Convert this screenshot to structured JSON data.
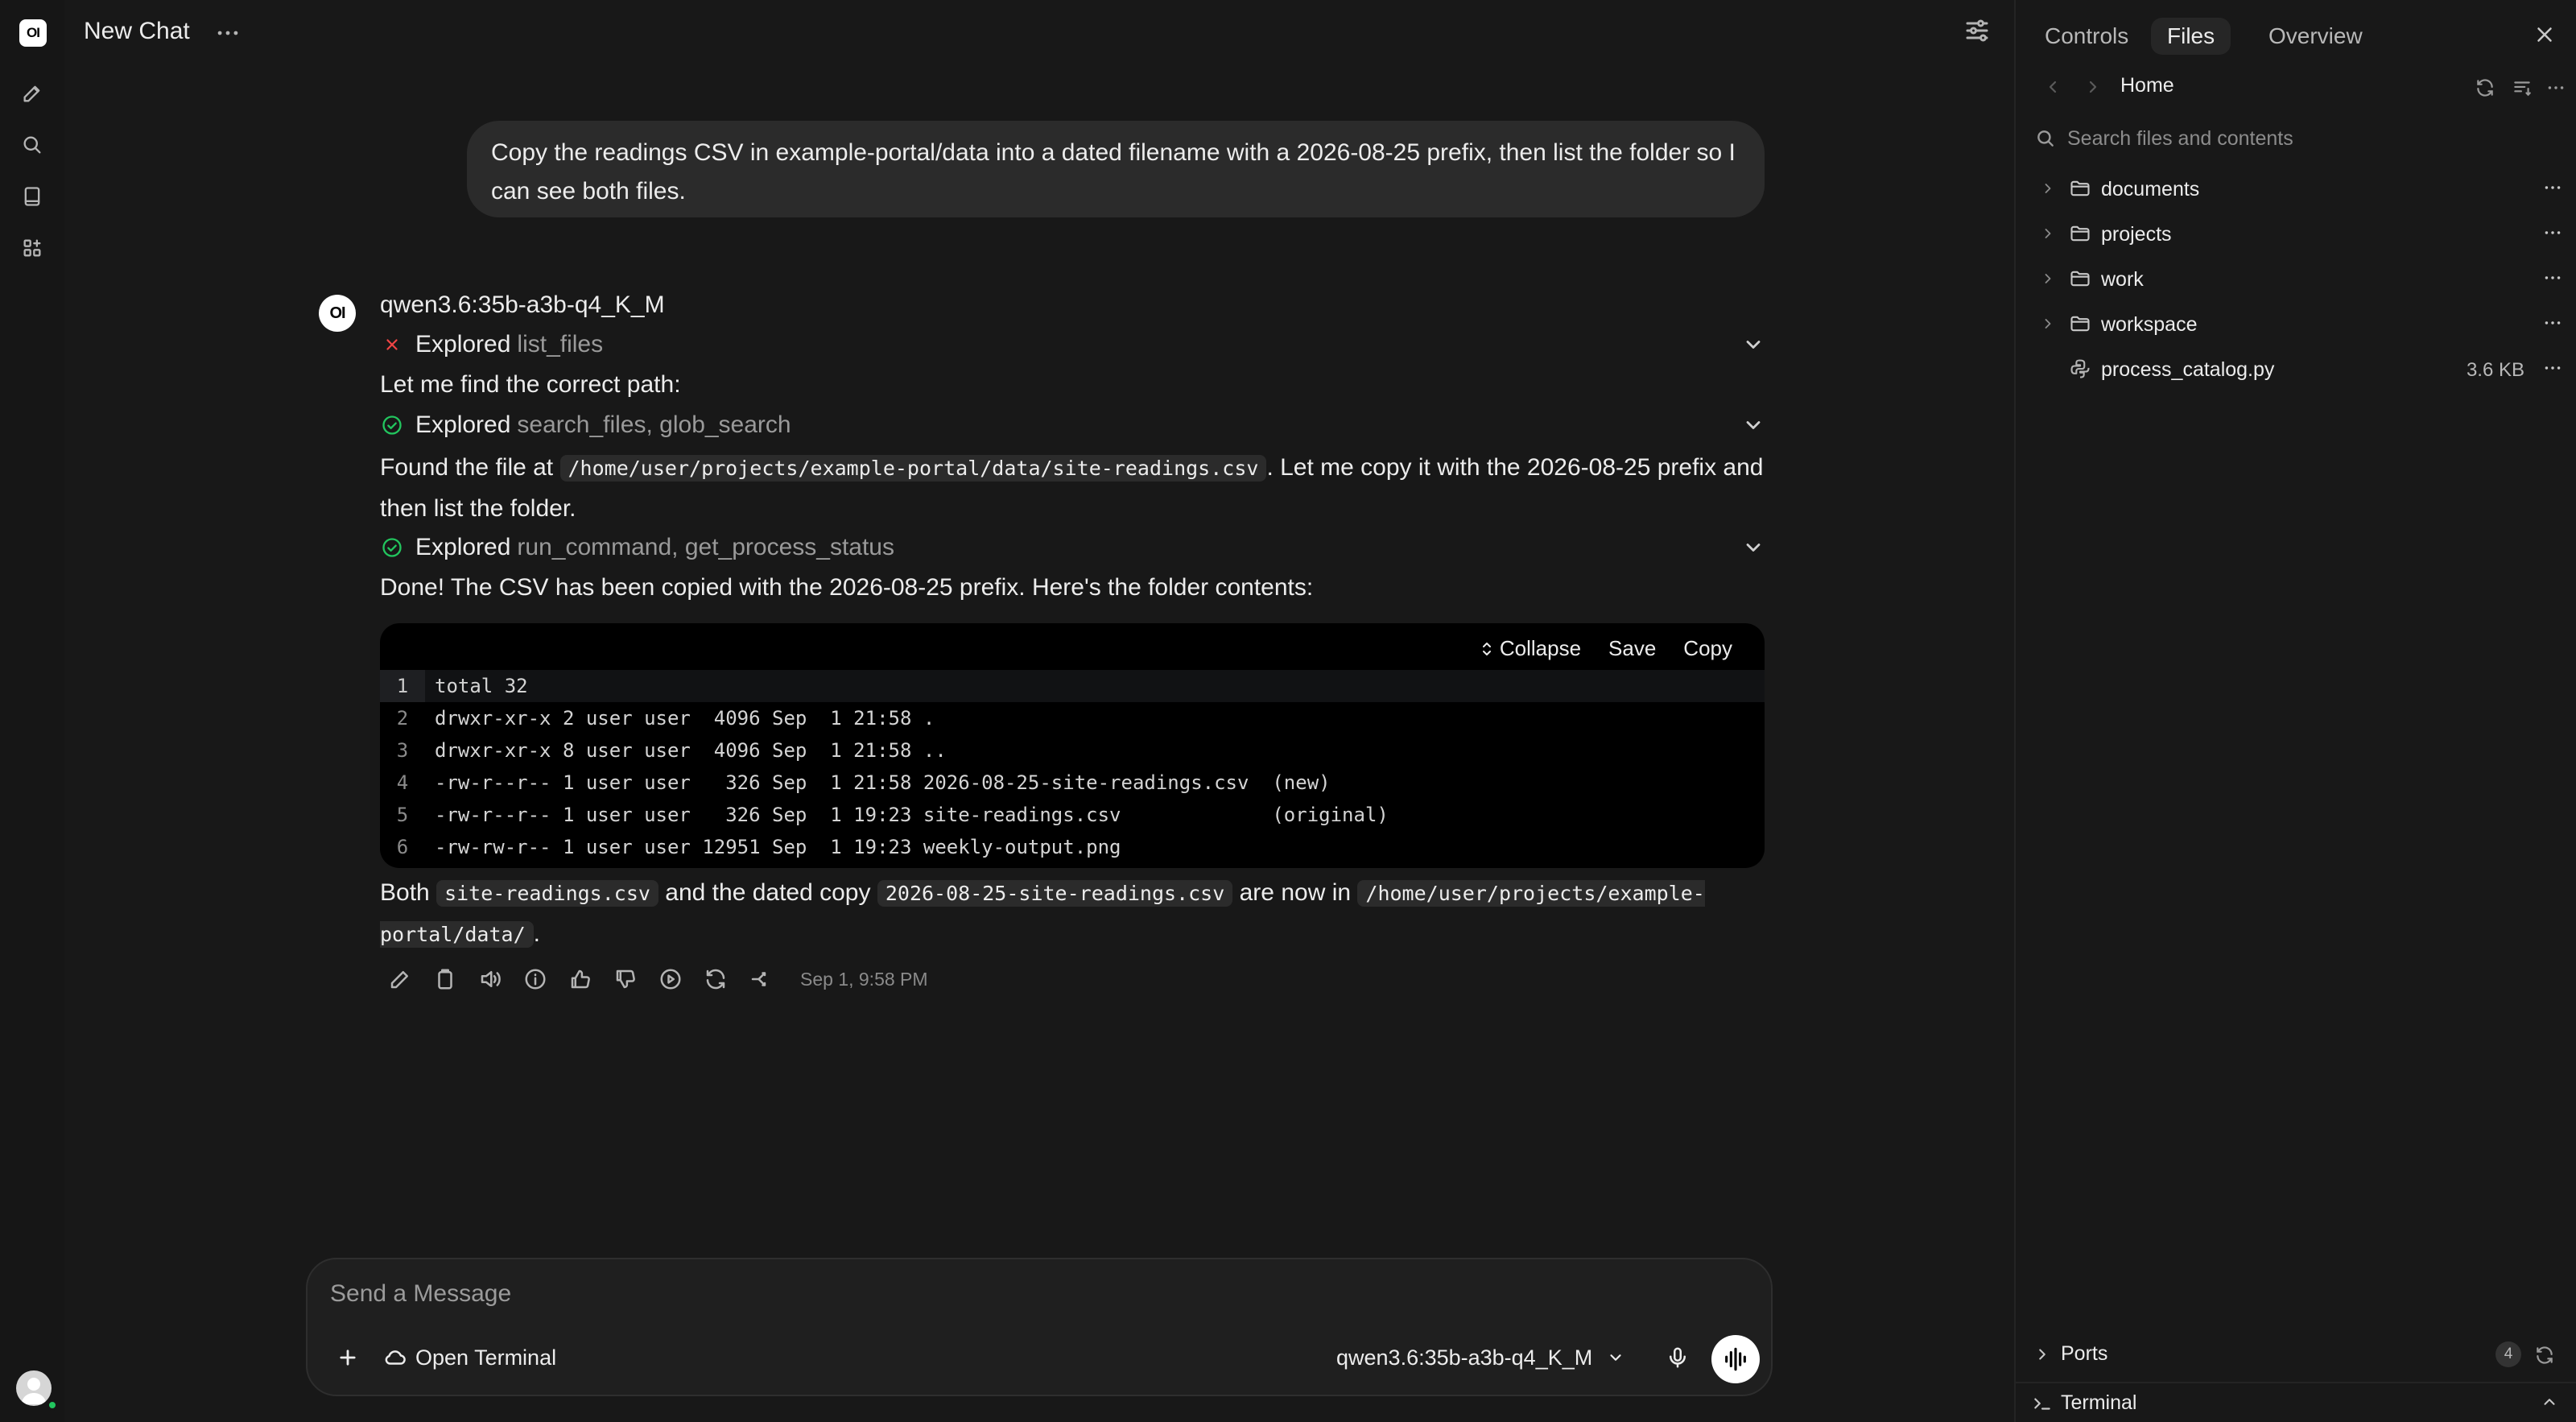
{
  "header": {
    "title": "New Chat"
  },
  "user_message": "Copy the readings CSV in example-portal/data into a dated filename with a 2026-08-25 prefix, then list the folder so I can see both files.",
  "assistant": {
    "avatar_text": "OI",
    "model": "qwen3.6:35b-a3b-q4_K_M",
    "steps": [
      {
        "status": "error",
        "label": "Explored",
        "tools": "list_files"
      },
      {
        "status": "success",
        "label": "Explored",
        "tools": "search_files, glob_search"
      },
      {
        "status": "success",
        "label": "Explored",
        "tools": "run_command, get_process_status"
      }
    ],
    "p1": "Let me find the correct path:",
    "p2_pre": "Found the file at",
    "p2_code": "/home/user/projects/example-portal/data/site-readings.csv",
    "p2_post": ". Let me copy it with the 2026-08-25 prefix and then list the folder.",
    "p3": "Done! The CSV has been copied with the 2026-08-25 prefix. Here's the folder contents:",
    "code_block": {
      "collapse": "Collapse",
      "save": "Save",
      "copy": "Copy",
      "lines": [
        "total 32",
        "drwxr-xr-x 2 user user  4096 Sep  1 21:58 .",
        "drwxr-xr-x 8 user user  4096 Sep  1 21:58 ..",
        "-rw-r--r-- 1 user user   326 Sep  1 21:58 2026-08-25-site-readings.csv  (new)",
        "-rw-r--r-- 1 user user   326 Sep  1 19:23 site-readings.csv             (original)",
        "-rw-rw-r-- 1 user user 12951 Sep  1 19:23 weekly-output.png"
      ]
    },
    "p4_a": "Both",
    "p4_code1": "site-readings.csv",
    "p4_b": "and the dated copy",
    "p4_code2": "2026-08-25-site-readings.csv",
    "p4_c": "are now in",
    "p4_code3": "/home/user/projects/example-portal/data/",
    "p4_d": ".",
    "timestamp": "Sep 1, 9:58 PM"
  },
  "composer": {
    "placeholder": "Send a Message",
    "terminal_label": "Open Terminal",
    "model": "qwen3.6:35b-a3b-q4_K_M"
  },
  "panel": {
    "tabs": [
      "Controls",
      "Files",
      "Overview"
    ],
    "active_tab": "Files",
    "breadcrumb": "Home",
    "search_placeholder": "Search files and contents",
    "items": [
      {
        "type": "folder",
        "name": "documents"
      },
      {
        "type": "folder",
        "name": "projects"
      },
      {
        "type": "folder",
        "name": "work"
      },
      {
        "type": "folder",
        "name": "workspace"
      },
      {
        "type": "file",
        "name": "process_catalog.py",
        "size": "3.6 KB"
      }
    ],
    "ports_label": "Ports",
    "ports_count": "4",
    "terminal_label": "Terminal"
  },
  "colors": {
    "background": "#181818",
    "bubble": "#2b2b2b",
    "success": "#22c55e",
    "error": "#ef4444"
  }
}
